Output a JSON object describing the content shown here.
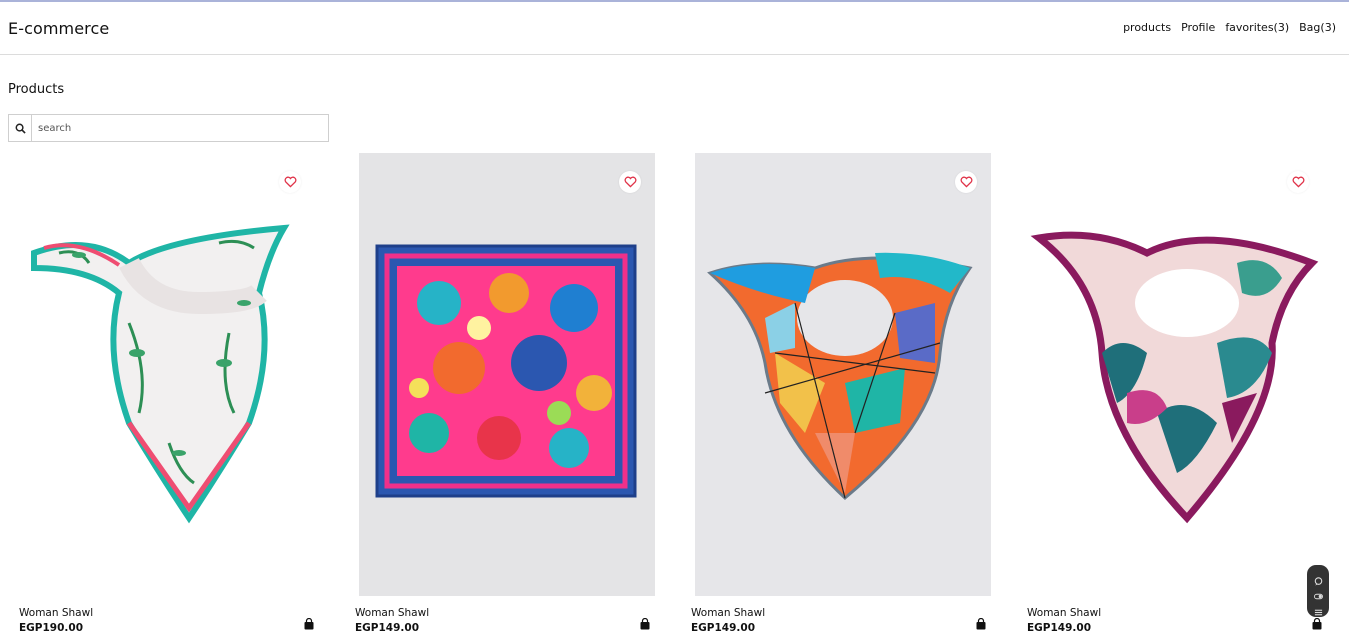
{
  "app": {
    "brand": "E-commerce"
  },
  "nav": {
    "products": "products",
    "profile": "Profile",
    "favorites": "favorites(3)",
    "bag": "Bag(3)"
  },
  "page": {
    "title": "Products"
  },
  "search": {
    "placeholder": "search",
    "value": ""
  },
  "products": [
    {
      "name": "Woman Shawl",
      "price": "EGP190.00",
      "image_bg": "#ffffff"
    },
    {
      "name": "Woman Shawl",
      "price": "EGP149.00",
      "image_bg": "#e4e4e6"
    },
    {
      "name": "Woman Shawl",
      "price": "EGP149.00",
      "image_bg": "#e6e6e9"
    },
    {
      "name": "Woman Shawl",
      "price": "EGP149.00",
      "image_bg": "#ffffff"
    }
  ],
  "colors": {
    "heart": "#e0344a",
    "text": "#111111",
    "border": "#dcdcdc"
  },
  "icons": [
    "search-icon",
    "heart-icon",
    "bag-icon",
    "chat-icon",
    "toggle-icon",
    "menu-icon"
  ]
}
